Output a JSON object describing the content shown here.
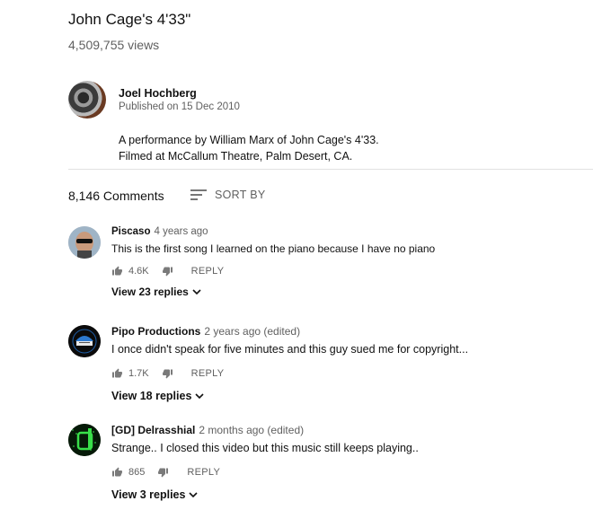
{
  "video": {
    "title": "John Cage's 4'33\"",
    "views": "4,509,755 views"
  },
  "channel": {
    "name": "Joel Hochberg",
    "published": "Published on 15 Dec 2010",
    "description_line1": "A performance by William Marx of John Cage's 4'33.",
    "description_line2": "Filmed at McCallum Theatre, Palm Desert, CA."
  },
  "comments_header": {
    "count": "8,146 Comments",
    "sort_label": "SORT BY"
  },
  "comments": [
    {
      "author": "Piscaso",
      "time": "4 years ago",
      "text": "This is the first song I learned on the piano because I have no piano",
      "likes": "4.6K",
      "reply_label": "REPLY",
      "replies_label": "View 23 replies"
    },
    {
      "author": "Pipo Productions",
      "time": "2 years ago (edited)",
      "text": "I once didn't speak for five minutes and this guy sued me for copyright...",
      "likes": "1.7K",
      "reply_label": "REPLY",
      "replies_label": "View 18 replies"
    },
    {
      "author": "[GD] Delrasshial",
      "time": "2 months ago (edited)",
      "text": "Strange.. I closed this video but this music still keeps playing..",
      "likes": "865",
      "reply_label": "REPLY",
      "replies_label": "View 3 replies"
    }
  ]
}
